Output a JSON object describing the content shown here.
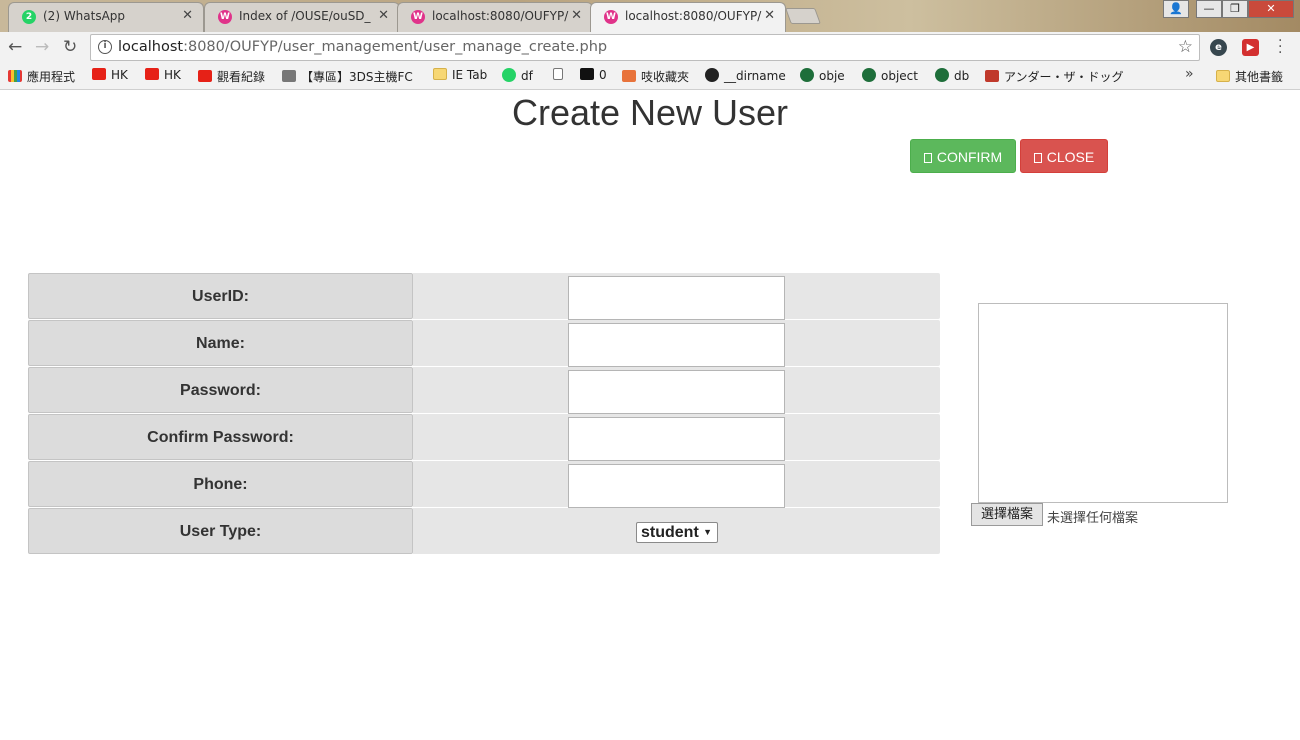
{
  "browser": {
    "tabs": [
      {
        "title": "(2) WhatsApp",
        "icon": "whatsapp-icon",
        "active": false
      },
      {
        "title": "Index of /OUSE/ouSD_",
        "icon": "wamp-icon",
        "active": false
      },
      {
        "title": "localhost:8080/OUFYP/",
        "icon": "wamp-icon",
        "active": false
      },
      {
        "title": "localhost:8080/OUFYP/",
        "icon": "wamp-icon",
        "active": true
      }
    ],
    "whatsapp_badge": "2",
    "window_controls": {
      "user": "👤",
      "minimize": "—",
      "maximize": "❐",
      "close": "✕"
    },
    "url_host": "localhost",
    "url_rest": ":8080/OUFYP/user_management/user_manage_create.php",
    "bookmarks": [
      {
        "label": "應用程式",
        "icon": "apps-icon"
      },
      {
        "label": "HK",
        "icon": "youtube-icon"
      },
      {
        "label": "HK",
        "icon": "youtube-icon"
      },
      {
        "label": "觀看紀錄",
        "icon": "youtube-icon"
      },
      {
        "label": "【專區】3DS主機FC",
        "icon": "dragon-icon"
      },
      {
        "label": "IE Tab",
        "icon": "folder-icon"
      },
      {
        "label": "df",
        "icon": "whatsapp-icon"
      },
      {
        "label": "",
        "icon": "page-icon"
      },
      {
        "label": "0",
        "icon": "bean-icon"
      },
      {
        "label": "吱收藏夾",
        "icon": "bookmark-icon"
      },
      {
        "label": "__dirname",
        "icon": "github-icon"
      },
      {
        "label": "obje",
        "icon": "db-icon"
      },
      {
        "label": "object",
        "icon": "db-icon"
      },
      {
        "label": "db",
        "icon": "db-icon"
      },
      {
        "label": "アンダー・ザ・ドッグ",
        "icon": "anime-icon"
      },
      {
        "label": "其他書籤",
        "icon": "folder-icon"
      }
    ],
    "overflow_chevron": "»",
    "bean_badge": "0"
  },
  "page": {
    "title": "Create New User",
    "confirm_label": "CONFIRM",
    "close_label": "CLOSE",
    "form": {
      "rows": [
        {
          "label": "UserID:",
          "type": "text",
          "value": ""
        },
        {
          "label": "Name:",
          "type": "text",
          "value": ""
        },
        {
          "label": "Password:",
          "type": "text",
          "value": ""
        },
        {
          "label": "Confirm Password:",
          "type": "text",
          "value": ""
        },
        {
          "label": "Phone:",
          "type": "text",
          "value": ""
        },
        {
          "label": "User Type:",
          "type": "select",
          "value": "student"
        }
      ]
    },
    "file_button_label": "選擇檔案",
    "file_status": "未選擇任何檔案"
  },
  "colors": {
    "confirm": "#5cb85c",
    "close": "#d9534f",
    "label_bg": "#dcdcdc",
    "cell_bg": "#e6e6e6"
  }
}
